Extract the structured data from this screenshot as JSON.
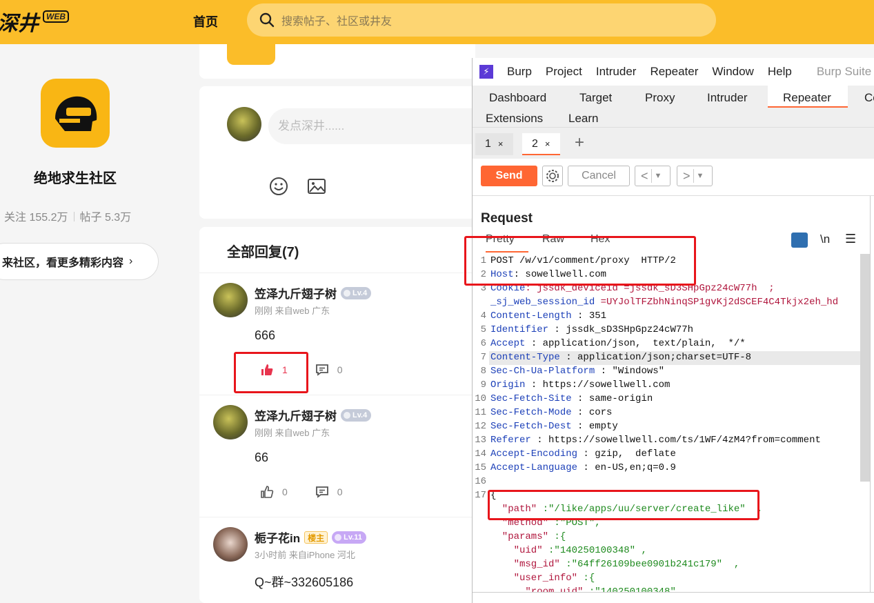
{
  "site": {
    "logo_text": "深井",
    "logo_badge": "WEB",
    "nav_home": "首页",
    "search_placeholder": "搜索帖子、社区或井友"
  },
  "community": {
    "name": "绝地求生社区",
    "followers": "关注 155.2万",
    "posts": "帖子 5.3万",
    "cta": "来社区，看更多精彩内容"
  },
  "composer": {
    "placeholder": "发点深井......"
  },
  "replies": {
    "title": "全部回复(7)",
    "items": [
      {
        "name": "笠泽九斤翅子树",
        "level": "Lv.4",
        "meta": "刚刚 来自web 广东",
        "text": "666",
        "likes": "1",
        "comments": "0",
        "liked": true
      },
      {
        "name": "笠泽九斤翅子树",
        "level": "Lv.4",
        "meta": "刚刚 来自web 广东",
        "text": "66",
        "likes": "0",
        "comments": "0",
        "liked": false
      },
      {
        "name": "栀子花in",
        "host_tag": "楼主",
        "level": "Lv.11",
        "meta": "3小时前 来自iPhone 河北",
        "text": "Q~群~332605186"
      }
    ]
  },
  "burp": {
    "menu": [
      "Burp",
      "Project",
      "Intruder",
      "Repeater",
      "Window",
      "Help"
    ],
    "title": "Burp Suite",
    "tabs_row1": [
      "Dashboard",
      "Target",
      "Proxy",
      "Intruder",
      "Repeater",
      "Co"
    ],
    "tabs_row2": [
      "Extensions",
      "Learn"
    ],
    "subtabs": [
      "1",
      "2"
    ],
    "send": "Send",
    "cancel": "Cancel",
    "request_title": "Request",
    "view_tabs": [
      "Pretty",
      "Raw",
      "Hex"
    ],
    "newline_btn": "\\n",
    "lines": [
      {
        "n": "1",
        "key": "POST /w/v1/comment/proxy  HTTP/2",
        "val": ""
      },
      {
        "n": "2",
        "key": "Host",
        "val": ": sowellwell.com"
      },
      {
        "n": "3",
        "key": "Cookie",
        "val": ": jssdk_deviceid =jssdk_sD3SHpGpz24cW77h  ;"
      },
      {
        "n": "",
        "key": "_sj_web_session_id",
        "val": " =UYJolTFZbhNinqSP1gvKj2dSCEF4C4Tkjx2eh_hd"
      },
      {
        "n": "4",
        "key": "Content-Length",
        "val": " : 351"
      },
      {
        "n": "5",
        "key": "Identifier",
        "val": " : jssdk_sD3SHpGpz24cW77h"
      },
      {
        "n": "6",
        "key": "Accept",
        "val": " : application/json,  text/plain,  */*"
      },
      {
        "n": "7",
        "key": "Content-Type",
        "val": " : application/json;charset=UTF-8"
      },
      {
        "n": "8",
        "key": "Sec-Ch-Ua-Platform",
        "val": " : \"Windows\""
      },
      {
        "n": "9",
        "key": "Origin",
        "val": " : https://sowellwell.com"
      },
      {
        "n": "10",
        "key": "Sec-Fetch-Site",
        "val": " : same-origin"
      },
      {
        "n": "11",
        "key": "Sec-Fetch-Mode",
        "val": " : cors"
      },
      {
        "n": "12",
        "key": "Sec-Fetch-Dest",
        "val": " : empty"
      },
      {
        "n": "13",
        "key": "Referer",
        "val": " : https://sowellwell.com/ts/1WF/4zM4?from=comment"
      },
      {
        "n": "14",
        "key": "Accept-Encoding",
        "val": " : gzip,  deflate"
      },
      {
        "n": "15",
        "key": "Accept-Language",
        "val": " : en-US,en;q=0.9"
      },
      {
        "n": "16",
        "key": "",
        "val": ""
      },
      {
        "n": "17",
        "key": "{",
        "val": ""
      },
      {
        "n": "",
        "key": "  \"path\"",
        "val": " :\"/like/apps/uu/server/create_like\"  ,"
      },
      {
        "n": "",
        "key": "  \"method\"",
        "val": " :\"POST\","
      },
      {
        "n": "",
        "key": "  \"params\"",
        "val": " :{"
      },
      {
        "n": "",
        "key": "    \"uid\"",
        "val": " :\"140250100348\" ,"
      },
      {
        "n": "",
        "key": "    \"msg_id\"",
        "val": " :\"64ff26109bee0901b241c179\"  ,"
      },
      {
        "n": "",
        "key": "    \"user_info\"",
        "val": " :{"
      },
      {
        "n": "",
        "key": "      \"room_uid\"",
        "val": " :\"140250100348\""
      }
    ]
  }
}
